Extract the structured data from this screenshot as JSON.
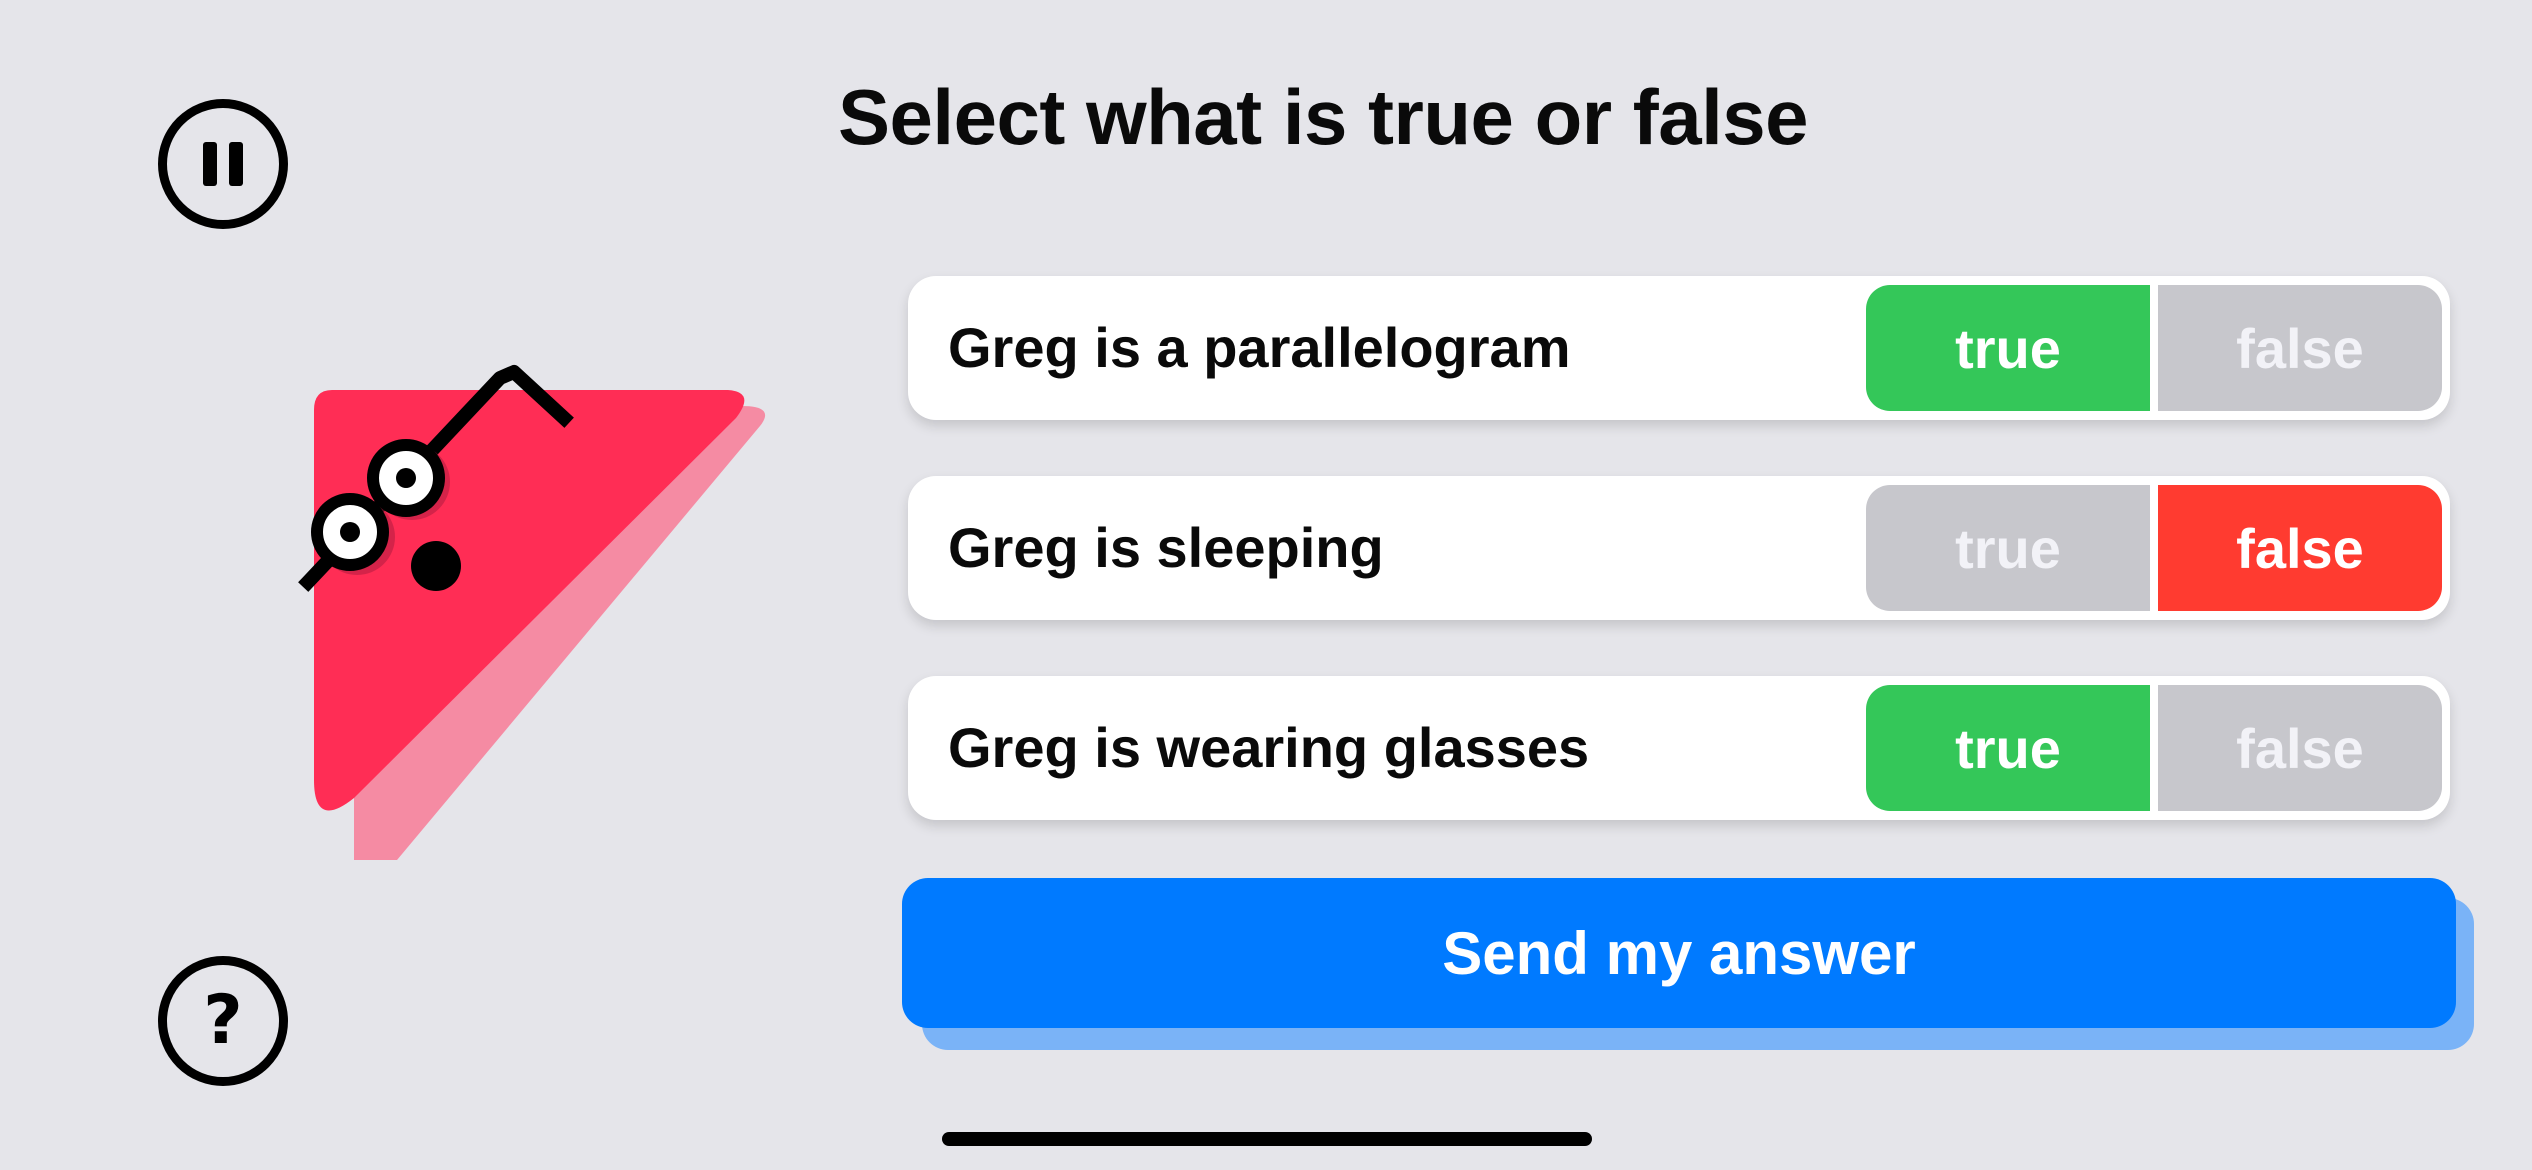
{
  "title": "Select what is true or false",
  "pause_button": {
    "icon": "pause-icon"
  },
  "help_button": {
    "icon": "question-icon",
    "glyph": "?"
  },
  "character": {
    "name": "Greg",
    "color": "#ff2d55",
    "shadow_color": "#f58ba3"
  },
  "statements": [
    {
      "label": "Greg is a parallelogram",
      "true_label": "true",
      "false_label": "false",
      "selected": "true"
    },
    {
      "label": "Greg is sleeping",
      "true_label": "true",
      "false_label": "false",
      "selected": "false"
    },
    {
      "label": "Greg is wearing glasses",
      "true_label": "true",
      "false_label": "false",
      "selected": "true"
    }
  ],
  "send_button": {
    "label": "Send my answer"
  },
  "colors": {
    "background": "#e5e5ea",
    "true_selected": "#34c759",
    "false_selected": "#ff3b30",
    "unselected": "#c7c7cc",
    "accent": "#007aff"
  }
}
